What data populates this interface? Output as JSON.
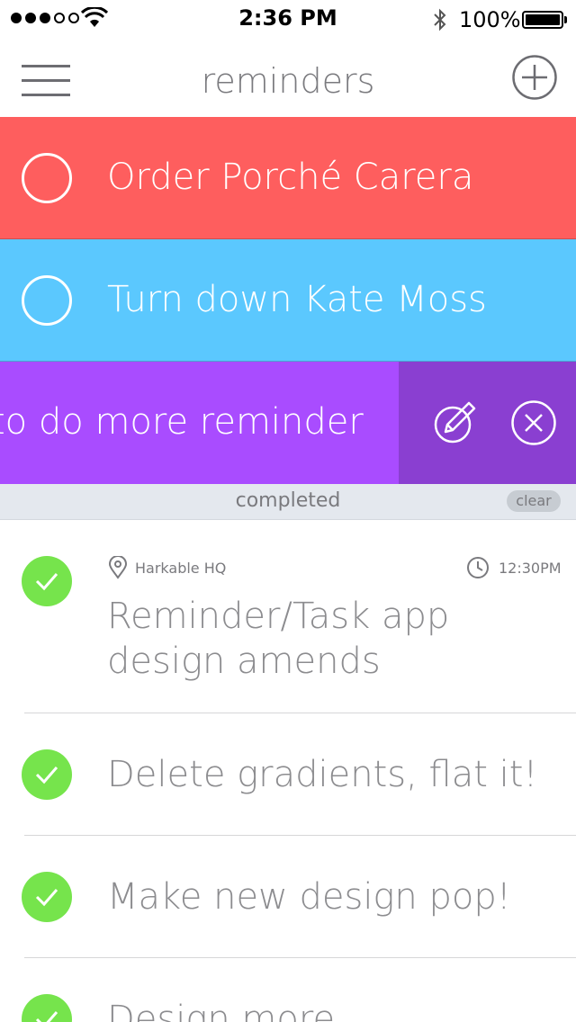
{
  "status_bar": {
    "time": "2:36 PM",
    "battery": "100%",
    "signal_bars_filled": 3,
    "signal_bars_total": 5
  },
  "nav": {
    "title": "reminders",
    "menu_icon": "hamburger-menu-icon",
    "add_icon": "plus-circle-icon"
  },
  "reminders": [
    {
      "text": "Order Porché Carera",
      "color": "#fe5e5e"
    },
    {
      "text": "Turn down Kate Moss",
      "color": "#5bc8fe"
    },
    {
      "text": "to do more reminder",
      "color": "#a94cff",
      "swiped": true
    }
  ],
  "row_actions": {
    "edit_icon": "pencil-circle-icon",
    "delete_icon": "close-circle-icon",
    "color": "#8a3fd1"
  },
  "completed": {
    "header": "completed",
    "clear_label": "clear",
    "check_color": "#76e44c",
    "items": [
      {
        "location": "Harkable HQ",
        "time": "12:30PM",
        "text_line1": "Reminder/Task app",
        "text_line2": "design amends"
      },
      {
        "text": "Delete gradients, flat it!"
      },
      {
        "text": "Make new design pop!"
      },
      {
        "text": "Design more"
      }
    ]
  }
}
